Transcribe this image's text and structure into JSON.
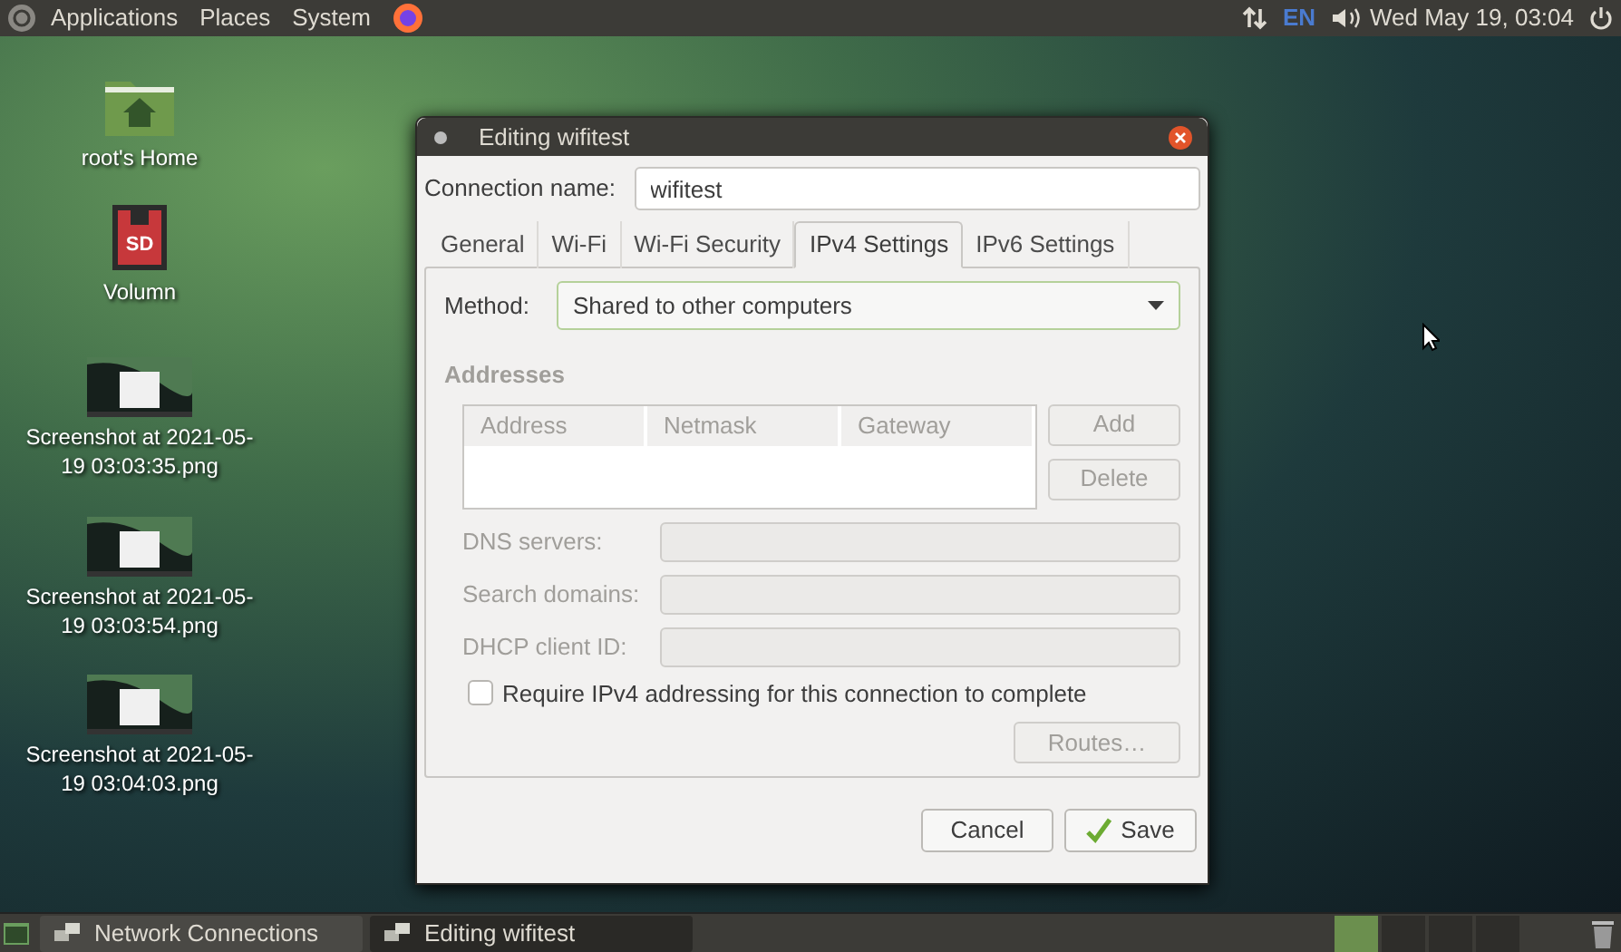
{
  "top_panel": {
    "menus": [
      "Applications",
      "Places",
      "System"
    ],
    "keyboard": "EN",
    "clock": "Wed May 19, 03:04"
  },
  "desktop_icons": [
    {
      "label": "root's Home",
      "kind": "folder"
    },
    {
      "label": "Volumn",
      "kind": "sd",
      "badge": "SD"
    },
    {
      "label": "Screenshot at 2021-05-19 03:03:35.png",
      "kind": "image"
    },
    {
      "label": "Screenshot at 2021-05-19 03:03:54.png",
      "kind": "image"
    },
    {
      "label": "Screenshot at 2021-05-19 03:04:03.png",
      "kind": "image"
    }
  ],
  "dialog": {
    "title": "Editing wifitest",
    "connection_name": {
      "label": "Connection name:",
      "value": "wifitest"
    },
    "tabs": [
      {
        "label": "General",
        "selected": false
      },
      {
        "label": "Wi-Fi",
        "selected": false
      },
      {
        "label": "Wi-Fi Security",
        "selected": false
      },
      {
        "label": "IPv4 Settings",
        "selected": true
      },
      {
        "label": "IPv6 Settings",
        "selected": false
      }
    ],
    "method": {
      "label": "Method:",
      "value": "Shared to other computers"
    },
    "addresses": {
      "title": "Addresses",
      "disabled": true,
      "columns": [
        "Address",
        "Netmask",
        "Gateway"
      ],
      "buttons": [
        {
          "label": "Add",
          "disabled": true
        },
        {
          "label": "Delete",
          "disabled": true
        }
      ]
    },
    "fields": [
      {
        "label": "DNS servers:",
        "disabled": true
      },
      {
        "label": "Search domains:",
        "disabled": true
      },
      {
        "label": "DHCP client ID:",
        "disabled": true
      }
    ],
    "checkbox": {
      "label": "Require IPv4 addressing for this connection to complete",
      "checked": false
    },
    "routes_button": {
      "label": "Routes…",
      "disabled": true
    },
    "buttons": [
      {
        "label": "Cancel",
        "kind": "plain"
      },
      {
        "label": "Save",
        "kind": "confirm"
      }
    ]
  },
  "taskbar": {
    "items": [
      {
        "label": "Network Connections",
        "selected": false
      },
      {
        "label": "Editing wifitest",
        "selected": true
      }
    ],
    "workspaces": [
      {
        "selected": true
      },
      {
        "selected": false
      },
      {
        "selected": false
      },
      {
        "selected": false
      }
    ]
  }
}
